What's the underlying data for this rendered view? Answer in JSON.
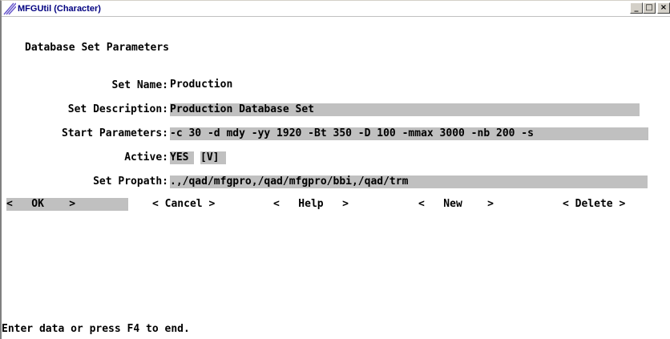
{
  "window": {
    "title": "MFGUtil (Character)",
    "controls": {
      "minimize": "_",
      "maximize": "□",
      "close": "×"
    }
  },
  "form": {
    "heading": "Database Set Parameters",
    "set_name_label": "Set Name:",
    "set_name_value": "Production",
    "set_description_label": "Set Description:",
    "set_description_value": "Production Database Set",
    "start_parameters_label": "Start Parameters:",
    "start_parameters_value": "-c 30 -d mdy -yy 1920 -Bt 350 -D 100 -mmax 3000 -nb 200 -s",
    "active_label": "Active:",
    "active_value": "YES",
    "active_toggle": "[V]",
    "set_propath_label": "Set Propath:",
    "set_propath_value": ".,/qad/mfgpro,/qad/mfgpro/bbi,/qad/trm"
  },
  "buttons": {
    "ok": "<   OK    >",
    "cancel": "< Cancel >",
    "help": "<   Help   >",
    "new": "<   New    >",
    "delete": "< Delete >"
  },
  "status": {
    "message": "Enter data or press F4 to end."
  }
}
